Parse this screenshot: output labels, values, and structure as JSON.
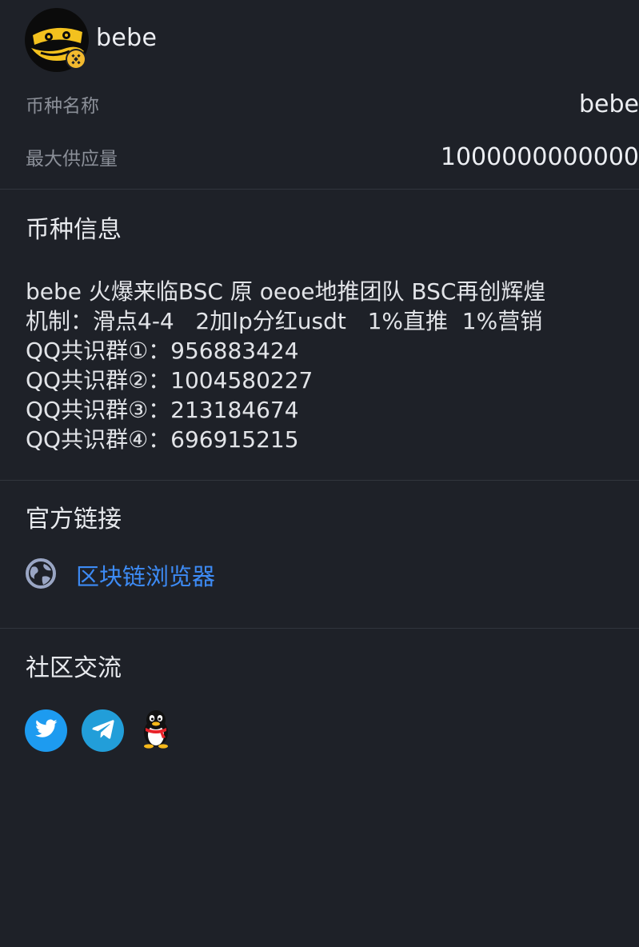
{
  "token": {
    "name": "bebe",
    "avatar_icon": "bebe-token-avatar-icon",
    "chain_badge_icon": "bnb-chain-badge-icon"
  },
  "info_rows": [
    {
      "label": "币种名称",
      "value": "bebe"
    },
    {
      "label": "最大供应量",
      "value": "1000000000000"
    }
  ],
  "sections": {
    "token_info_title": "币种信息",
    "links_title": "官方链接",
    "community_title": "社区交流"
  },
  "description": {
    "lines": [
      "bebe 火爆来临BSC 原 oeoe地推团队 BSC再创辉煌",
      "机制：滑点4-4   2加lp分红usdt   1%直推  1%营销",
      "QQ共识群①：956883424",
      "QQ共识群②：1004580227",
      "QQ共识群③：213184674",
      "QQ共识群④：696915215"
    ]
  },
  "links": [
    {
      "label": "区块链浏览器",
      "icon": "globe-icon"
    }
  ],
  "community": [
    {
      "name": "twitter",
      "icon": "twitter-icon",
      "color": "#1d9bf0"
    },
    {
      "name": "telegram",
      "icon": "telegram-icon",
      "color": "#229ed9"
    },
    {
      "name": "qq",
      "icon": "qq-penguin-icon",
      "color": "#1e2128"
    }
  ],
  "colors": {
    "background": "#1e2128",
    "link": "#3d8bf5",
    "muted_label": "#8b8f98",
    "divider": "#31353d",
    "avatar_gold": "#f3c11e"
  }
}
